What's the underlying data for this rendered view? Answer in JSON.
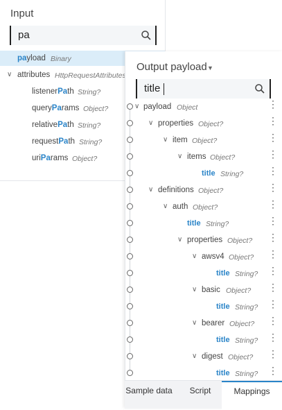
{
  "input": {
    "title": "Input",
    "search_value": "pa",
    "items": [
      {
        "pre": "",
        "hl": "pa",
        "post": "yload",
        "type": "Binary"
      },
      {
        "pre": "attributes",
        "hl": "",
        "post": "",
        "type": "HttpRequestAttributes"
      },
      {
        "pre": "listener",
        "hl": "Pa",
        "post": "th",
        "type": "String?"
      },
      {
        "pre": "query",
        "hl": "Pa",
        "post": "rams",
        "type": "Object?"
      },
      {
        "pre": "relative",
        "hl": "Pa",
        "post": "th",
        "type": "String?"
      },
      {
        "pre": "request",
        "hl": "Pa",
        "post": "th",
        "type": "String?"
      },
      {
        "pre": "uri",
        "hl": "Pa",
        "post": "rams",
        "type": "Object?"
      }
    ]
  },
  "output": {
    "title": "Output payload",
    "search_value": "title",
    "tree": [
      {
        "name": "payload",
        "type": "Object"
      },
      {
        "name": "properties",
        "type": "Object?"
      },
      {
        "name": "item",
        "type": "Object?"
      },
      {
        "name": "items",
        "type": "Object?"
      },
      {
        "name": "title",
        "type": "String?"
      },
      {
        "name": "definitions",
        "type": "Object?"
      },
      {
        "name": "auth",
        "type": "Object?"
      },
      {
        "name": "title",
        "type": "String?"
      },
      {
        "name": "properties",
        "type": "Object?"
      },
      {
        "name": "awsv4",
        "type": "Object?"
      },
      {
        "name": "title",
        "type": "String?"
      },
      {
        "name": "basic",
        "type": "Object?"
      },
      {
        "name": "title",
        "type": "String?"
      },
      {
        "name": "bearer",
        "type": "Object?"
      },
      {
        "name": "title",
        "type": "String?"
      },
      {
        "name": "digest",
        "type": "Object?"
      },
      {
        "name": "title",
        "type": "String?"
      }
    ]
  },
  "tabs": [
    "Sample data",
    "Script",
    "Mappings"
  ],
  "colors": {
    "accent": "#2a84c8",
    "selected_bg": "#dbedf9"
  }
}
